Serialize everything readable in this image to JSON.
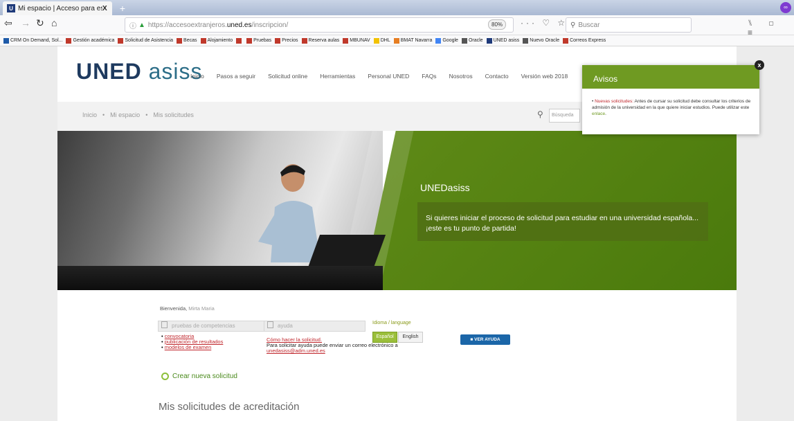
{
  "browser": {
    "tab_title": "Mi espacio | Acceso para estud",
    "tab_close": "X",
    "new_tab": "+",
    "profile_icon": "∞",
    "url_prefix": "https://accesoextranjeros.",
    "url_domain": "uned.es",
    "url_path": "/inscripcion/",
    "zoom": "80%",
    "page_actions": "··· ♡ ☆",
    "search_placeholder": "Buscar",
    "right_nav": "⑊ ▢ ≡",
    "bookmarks": [
      {
        "label": "CRM On Demand, Sol...",
        "color": "#1e5aa8"
      },
      {
        "label": "Gestión académica",
        "color": "#c0392b"
      },
      {
        "label": "Solicitud de Asistencia",
        "color": "#c0392b"
      },
      {
        "label": "Becas",
        "color": "#c0392b"
      },
      {
        "label": "Alojamiento",
        "color": "#c0392b"
      },
      {
        "label": "",
        "color": "#c0392b"
      },
      {
        "label": "Pruebas",
        "color": "#c0392b"
      },
      {
        "label": "Precios",
        "color": "#c0392b"
      },
      {
        "label": "Reserva aulas",
        "color": "#c0392b"
      },
      {
        "label": "MBUNAV",
        "color": "#c0392b"
      },
      {
        "label": "DHL",
        "color": "#f2c200"
      },
      {
        "label": "BMAT Navarra",
        "color": "#e67e22"
      },
      {
        "label": "Google",
        "color": "#4285f4"
      },
      {
        "label": "Oracle",
        "color": "#555555"
      },
      {
        "label": "UNED asiss",
        "color": "#1f3a7a"
      },
      {
        "label": "Nuevo Oracle",
        "color": "#555555"
      },
      {
        "label": "Correos Express",
        "color": "#c0392b"
      }
    ]
  },
  "site": {
    "logo_bold": "UNED",
    "logo_light": "asiss",
    "nav": [
      "Inicio",
      "Pasos a seguir",
      "Solicitud online",
      "Herramientas",
      "Personal UNED",
      "FAQs",
      "Nosotros",
      "Contacto",
      "Versión web 2018"
    ],
    "breadcrumb": [
      "Inicio",
      "Mi espacio",
      "Mis solicitudes"
    ],
    "breadcrumb_sep": "•",
    "search_placeholder": "Búsqueda",
    "hero_title": "UNEDasiss",
    "hero_text": "Si quieres iniciar el proceso de solicitud para estudiar en una universidad española... ¡este es tu punto de partida!",
    "welcome_label": "Bienvenida,",
    "welcome_name": "Mirta Maria",
    "box1_label": "pruebas de competencias",
    "box2_label": "ayuda",
    "links1": [
      "convocatoria",
      "publicación de resultados",
      "modelos de examen"
    ],
    "help_link": "Cómo hacer la solicitud.",
    "help_text": "Para solicitar ayuda puede enviar un correo electrónico a",
    "help_email": "unedasiss@adm.uned.es",
    "lang_label": "Idioma / language",
    "lang_es": "Español",
    "lang_en": "English",
    "help_button": "VER AYUDA",
    "create_label": "Crear nueva solicitud",
    "section_title": "Mis solicitudes de acreditación"
  },
  "avisos": {
    "title": "Avisos",
    "label": "Nuevas solicitudes:",
    "text": "Antes de cursar su solicitud debe consultar los criterios de admisión de la universidad en la que quiere iniciar estudios. Puede utilizar este",
    "link": "enlace",
    "close": "x"
  }
}
